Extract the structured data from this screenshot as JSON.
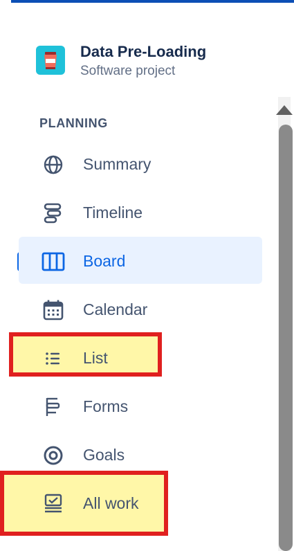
{
  "project": {
    "name": "Data Pre-Loading",
    "type": "Software project",
    "avatar_icon": "coffee-cup-icon"
  },
  "sidebar": {
    "section_heading": "PLANNING",
    "items": [
      {
        "label": "Summary",
        "icon": "globe-icon",
        "active": false
      },
      {
        "label": "Timeline",
        "icon": "timeline-icon",
        "active": false
      },
      {
        "label": "Board",
        "icon": "board-icon",
        "active": true
      },
      {
        "label": "Calendar",
        "icon": "calendar-icon",
        "active": false
      },
      {
        "label": "List",
        "icon": "list-icon",
        "active": false,
        "highlighted": true
      },
      {
        "label": "Forms",
        "icon": "forms-icon",
        "active": false
      },
      {
        "label": "Goals",
        "icon": "goals-icon",
        "active": false
      },
      {
        "label": "All work",
        "icon": "all-work-icon",
        "active": false,
        "highlighted": true
      }
    ]
  },
  "colors": {
    "accent": "#0c66e4",
    "active_background": "#e9f2ff",
    "highlight_fill": "#fff7a8",
    "highlight_border": "#e0201f",
    "text": "#44546f",
    "title": "#172b4d"
  }
}
